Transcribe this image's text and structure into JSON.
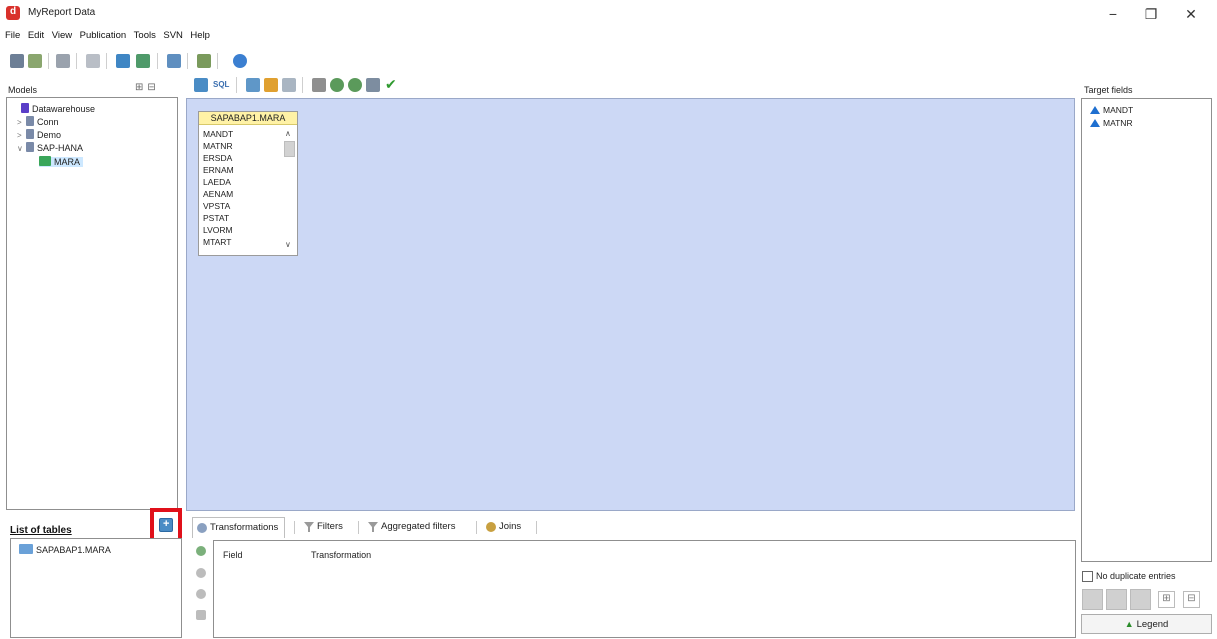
{
  "app": {
    "title": "MyReport Data",
    "win_minimize": "−",
    "win_restore": "❐",
    "win_close": "✕"
  },
  "menu": [
    "File",
    "Edit",
    "View",
    "Publication",
    "Tools",
    "SVN",
    "Help"
  ],
  "models": {
    "label": "Models",
    "expand_all": "⊞",
    "collapse_all": "⊟",
    "tree": [
      {
        "label": "Datawarehouse",
        "arrow": "",
        "level": 0,
        "icon_color": "#5a3ec8"
      },
      {
        "label": "Conn",
        "arrow": ">",
        "level": 0,
        "icon_color": "#7a8aa8"
      },
      {
        "label": "Demo",
        "arrow": ">",
        "level": 0,
        "icon_color": "#7a8aa8"
      },
      {
        "label": "SAP-HANA",
        "arrow": "∨",
        "level": 0,
        "icon_color": "#7a8aa8"
      },
      {
        "label": "MARA",
        "arrow": "",
        "level": 1,
        "icon_color": "#3aa65a",
        "selected": true
      }
    ]
  },
  "list_of_tables": {
    "label": "List of tables",
    "items": [
      "SAPABAP1.MARA"
    ]
  },
  "diagram": {
    "table_title": "SAPABAP1.MARA",
    "fields": [
      "MANDT",
      "MATNR",
      "ERSDA",
      "ERNAM",
      "LAEDA",
      "AENAM",
      "VPSTA",
      "PSTAT",
      "LVORM",
      "MTART"
    ],
    "scroll_up": "∧",
    "scroll_down": "∨"
  },
  "canvas_toolbar": {
    "sql_label": "SQL"
  },
  "tabs": [
    {
      "label": "Transformations",
      "active": true
    },
    {
      "label": "Filters",
      "active": false
    },
    {
      "label": "Aggregated filters",
      "active": false
    },
    {
      "label": "Joins",
      "active": false
    }
  ],
  "grid": {
    "col_field": "Field",
    "col_transformation": "Transformation"
  },
  "target": {
    "label": "Target fields",
    "fields": [
      "MANDT",
      "MATNR"
    ],
    "no_duplicate_label": "No duplicate entries",
    "legend_label": "Legend",
    "add_symbol": "⊞",
    "remove_symbol": "⊟"
  },
  "colors": {
    "canvas_bg": "#ccd8f5",
    "table_title_bg": "#fff2a6",
    "highlight_frame": "#e0101a",
    "target_icon": "#1e6fd0"
  }
}
